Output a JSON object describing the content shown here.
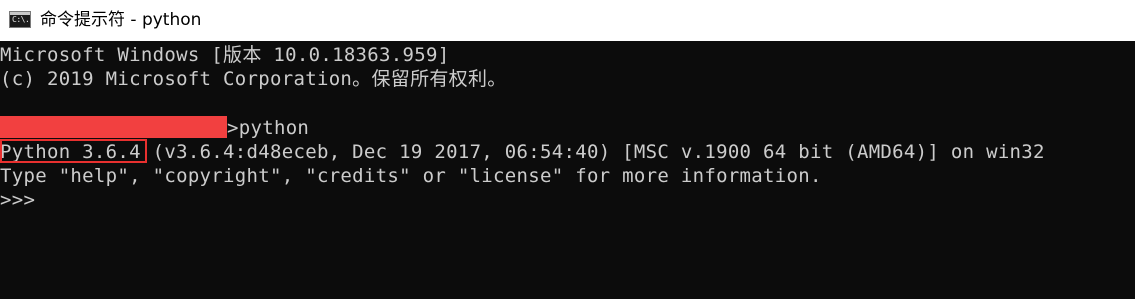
{
  "window": {
    "title": "命令提示符 - python",
    "icon": "cmd-icon",
    "icon_label": "C:\\."
  },
  "console": {
    "lines": [
      "Microsoft Windows [版本 10.0.18363.959]",
      "(c) 2019 Microsoft Corporation。保留所有权利。",
      "",
      ">python",
      "Python 3.6.4 (v3.6.4:d48eceb, Dec 19 2017, 06:54:40) [MSC v.1900 64 bit (AMD64)] on win32",
      "Type \"help\", \"copyright\", \"credits\" or \"license\" for more information.",
      ">>>"
    ],
    "command": ">python",
    "version_highlight": "Python 3.6.4",
    "version_rest": " (v3.6.4:d48eceb, Dec 19 2017, 06:54:40) [MSC v.1900 64 bit (AMD64)] on win32",
    "prompt": ">>>"
  },
  "colors": {
    "background": "#0c0c0c",
    "text": "#cccccc",
    "redaction": "#f24040",
    "highlight_border": "#e8302f"
  }
}
